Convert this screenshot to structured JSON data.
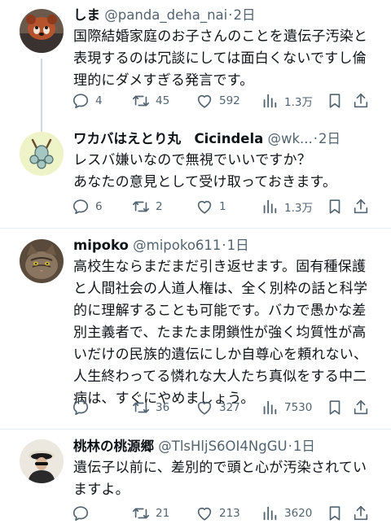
{
  "tweets": [
    {
      "name": "しま",
      "handle": "@panda_deha_nai",
      "sep": "·",
      "time": "2日",
      "lines": [
        "国際結婚家庭のお子さんのことを遺伝子汚染と",
        "表現するのは冗談にしては面白くないですし倫",
        "理的にダメすぎる発言です。"
      ],
      "comments": "4",
      "retweets": "45",
      "likes": "592",
      "views": "1.3万"
    },
    {
      "name": "ワカバはえとり丸　Cicindela",
      "handle": "@wk...",
      "sep": "·",
      "time": "2日",
      "lines": [
        "レスバ嫌いなので無視でいいですか？",
        "あなたの意見として受け取っておきます。"
      ],
      "comments": "6",
      "retweets": "2",
      "likes": "1",
      "views": "1.3万"
    },
    {
      "name": "mipoko",
      "handle": "@mipoko611",
      "sep": "·",
      "time": "1日",
      "lines": [
        "高校生ならまだまだ引き返せます。固有種保護",
        "と人間社会の人道人権は、全く別枠の話と科学",
        "的に理解することも可能です。バカで愚かな差",
        "別主義者で、たまたま閉鎖性が強く均質性が高",
        "いだけの民族的遺伝にしか自尊心を頼れない、",
        "人生終わってる憐れな大人たち真似をする中二",
        "病は、すぐにやめましょう。"
      ],
      "comments": "",
      "retweets": "36",
      "likes": "327",
      "views": "7530"
    },
    {
      "name": "桃林の桃源郷",
      "handle": "@TlsHljS6OI4NgGU",
      "sep": "·",
      "time": "1日",
      "lines": [
        "遺伝子以前に、差別的で頭と心が汚染されてい",
        "ますよ。"
      ],
      "comments": "",
      "retweets": "21",
      "likes": "213",
      "views": "3620"
    }
  ],
  "colors": {
    "text": "#0f1419",
    "secondary": "#536471",
    "divider": "#e6ecf0",
    "thread_line": "#cfd9de"
  },
  "icons": [
    "reply-icon",
    "retweet-icon",
    "like-icon",
    "views-icon",
    "bookmark-icon",
    "share-icon"
  ]
}
